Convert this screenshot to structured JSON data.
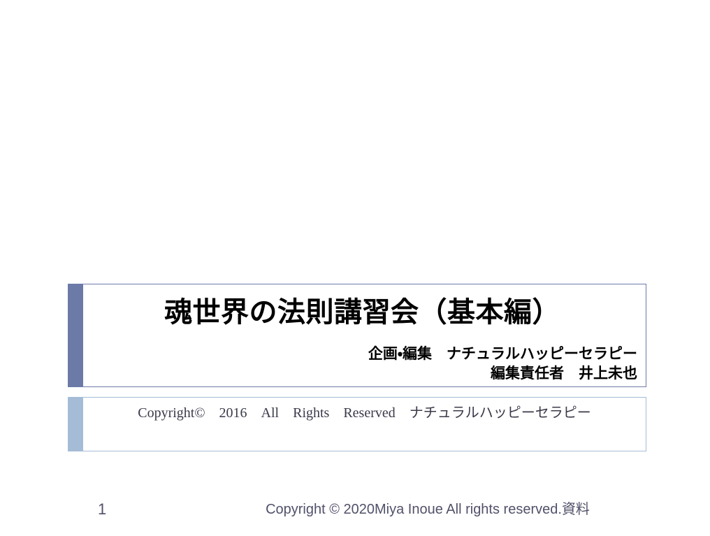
{
  "slide": {
    "background_color": "#ffffff",
    "title_block": {
      "accent_color": "#6c7aa8",
      "border_color": "#6c7aa8",
      "title": "魂世界の法則講習会（基本編）",
      "subtitle_lines": [
        "企画・編集　ナチュラルハッピーセラピー",
        "編集責任者　井上未也"
      ]
    },
    "copyright_block": {
      "accent_color": "#a5bcd6",
      "border_color": "#a5bcd6",
      "text": "Copyright©　2016　All　Rights　Reserved　ナチュラルハッピーセラピー"
    },
    "footer": {
      "page_number": "1",
      "copyright": "Copyright © 2020Miya Inoue All rights reserved.資料",
      "text_color": "#51516a"
    }
  }
}
